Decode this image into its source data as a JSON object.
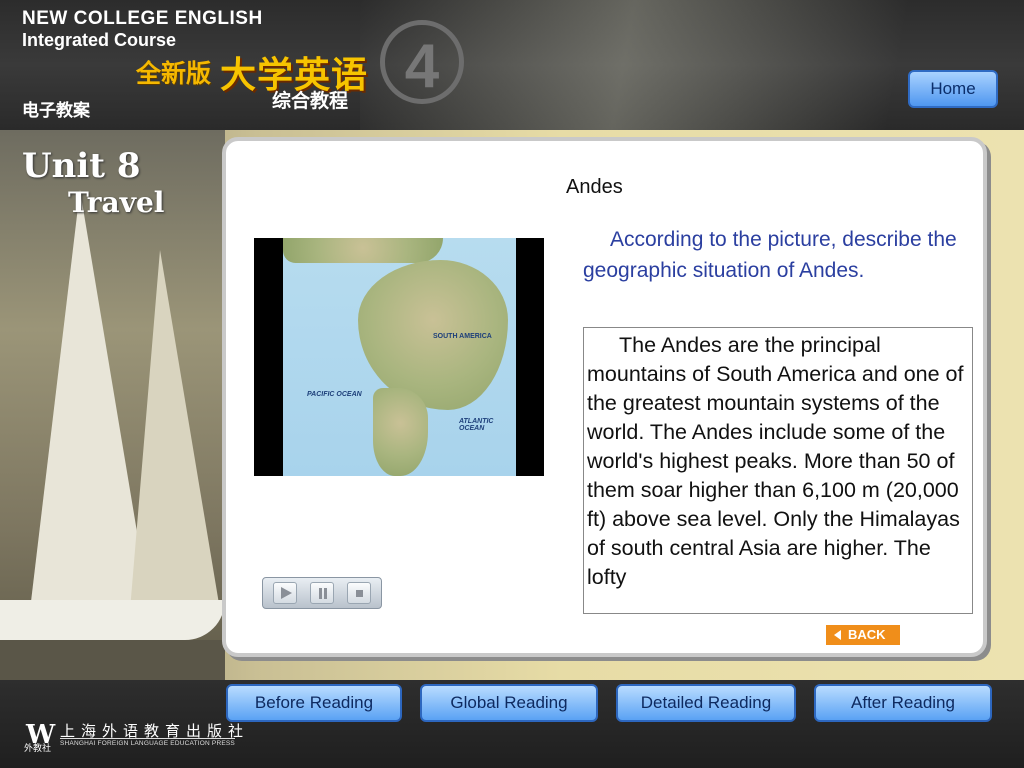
{
  "header": {
    "series_title": "NEW COLLEGE ENGLISH",
    "series_subtitle": "Integrated Course",
    "cn_edition": "全新版",
    "cn_title": "大学英语",
    "cn_course": "综合教程",
    "volume": "4",
    "cn_ebook": "电子教案",
    "home_label": "Home"
  },
  "sidebar": {
    "unit": "Unit 8",
    "unit_title": "Travel"
  },
  "content": {
    "title": "Andes",
    "prompt": "According to the picture, describe the geographic situation of Andes.",
    "passage": "The Andes are the principal mountains of South America and one of the greatest mountain systems of the world. The Andes include some of the world's highest peaks. More than 50 of them soar higher than 6,100 m (20,000 ft) above sea level. Only the Himalayas of south central Asia are higher. The lofty",
    "map_labels": {
      "pacific": "PACIFIC OCEAN",
      "atlantic": "ATLANTIC OCEAN",
      "south_america": "SOUTH AMERICA"
    },
    "back_label": "BACK"
  },
  "media_controls": {
    "play": "play-icon",
    "pause": "pause-icon",
    "stop": "stop-icon"
  },
  "bottom_nav": [
    {
      "label": "Before Reading"
    },
    {
      "label": "Global Reading"
    },
    {
      "label": "Detailed Reading"
    },
    {
      "label": "After Reading"
    }
  ],
  "publisher": {
    "logo": "W",
    "tag": "外教社",
    "name_cn": "上海外语教育出版社",
    "name_en": "SHANGHAI FOREIGN LANGUAGE EDUCATION PRESS"
  },
  "colors": {
    "accent_blue": "#4f97f0",
    "prompt_text": "#2b3fa0",
    "back_orange": "#f08e1a",
    "title_gold": "#f7c400"
  }
}
